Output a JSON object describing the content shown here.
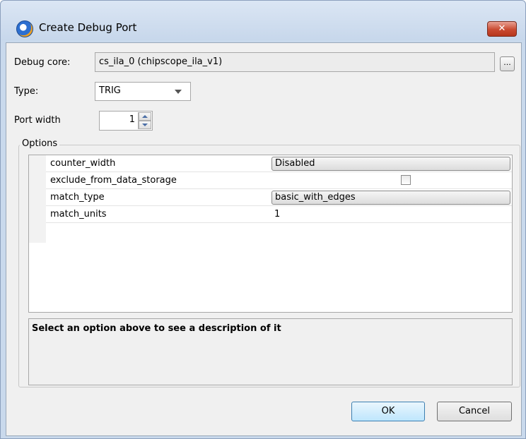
{
  "window": {
    "title": "Create Debug Port",
    "close_glyph": "✕"
  },
  "form": {
    "debug_core_label": "Debug core:",
    "debug_core_value": "cs_ila_0 (chipscope_ila_v1)",
    "browse_label": "...",
    "type_label": "Type:",
    "type_value": "TRIG",
    "port_width_label": "Port width",
    "port_width_value": "1"
  },
  "options": {
    "title": "Options",
    "rows": [
      {
        "name": "counter_width",
        "value": "Disabled",
        "kind": "button"
      },
      {
        "name": "exclude_from_data_storage",
        "value": "",
        "kind": "checkbox",
        "checked": false
      },
      {
        "name": "match_type",
        "value": "basic_with_edges",
        "kind": "button"
      },
      {
        "name": "match_units",
        "value": "1",
        "kind": "text"
      }
    ],
    "description": "Select an option above to see a description of it"
  },
  "buttons": {
    "ok": "OK",
    "cancel": "Cancel"
  },
  "icons": {
    "app": "app-icon",
    "close": "close-icon",
    "dropdown": "chevron-down-icon",
    "spin_up": "spin-up-icon",
    "spin_down": "spin-down-icon",
    "checkbox": "checkbox-icon"
  }
}
